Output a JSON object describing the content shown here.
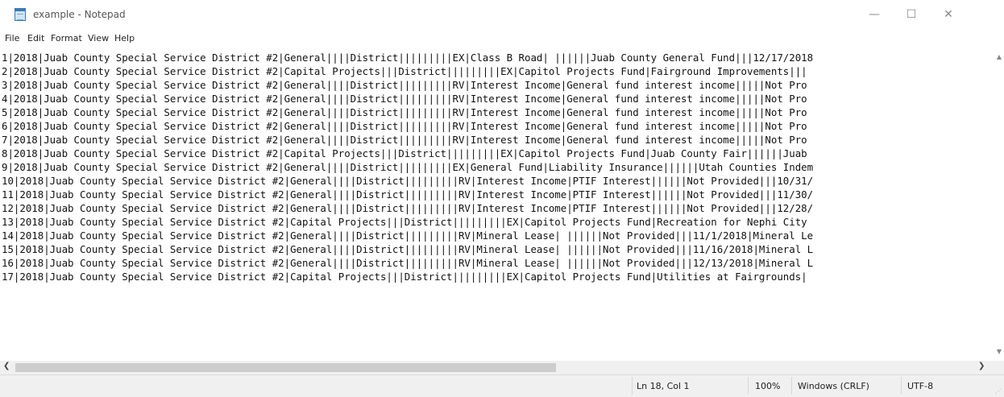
{
  "window": {
    "title": "example - Notepad",
    "minimize_glyph": "—",
    "maximize_glyph": "☐",
    "close_glyph": "✕",
    "icon": "notepad-icon"
  },
  "menu": [
    "File",
    "Edit",
    "Format",
    "View",
    "Help"
  ],
  "lines": [
    "1|2018|Juab County Special Service District #2|General||||District|||||||||EX|Class B Road| ||||||Juab County General Fund|||12/17/2018",
    "2|2018|Juab County Special Service District #2|Capital Projects|||District|||||||||EX|Capitol Projects Fund|Fairground Improvements|||",
    "3|2018|Juab County Special Service District #2|General||||District|||||||||RV|Interest Income|General fund interest income|||||Not Pro",
    "4|2018|Juab County Special Service District #2|General||||District|||||||||RV|Interest Income|General fund interest income|||||Not Pro",
    "5|2018|Juab County Special Service District #2|General||||District|||||||||RV|Interest Income|General fund interest income|||||Not Pro",
    "6|2018|Juab County Special Service District #2|General||||District|||||||||RV|Interest Income|General fund interest income|||||Not Pro",
    "7|2018|Juab County Special Service District #2|General||||District|||||||||RV|Interest Income|General fund interest income|||||Not Pro",
    "8|2018|Juab County Special Service District #2|Capital Projects|||District|||||||||EX|Capitol Projects Fund|Juab County Fair||||||Juab",
    "9|2018|Juab County Special Service District #2|General||||District|||||||||EX|General Fund|Liability Insurance||||||Utah Counties Indem",
    "10|2018|Juab County Special Service District #2|General||||District|||||||||RV|Interest Income|PTIF Interest||||||Not Provided|||10/31/",
    "11|2018|Juab County Special Service District #2|General||||District|||||||||RV|Interest Income|PTIF Interest||||||Not Provided|||11/30/",
    "12|2018|Juab County Special Service District #2|General||||District|||||||||RV|Interest Income|PTIF Interest||||||Not Provided|||12/28/",
    "13|2018|Juab County Special Service District #2|Capital Projects|||District|||||||||EX|Capitol Projects Fund|Recreation for Nephi City",
    "14|2018|Juab County Special Service District #2|General||||District|||||||||RV|Mineral Lease| ||||||Not Provided|||11/1/2018|Mineral Le",
    "15|2018|Juab County Special Service District #2|General||||District|||||||||RV|Mineral Lease| ||||||Not Provided|||11/16/2018|Mineral L",
    "16|2018|Juab County Special Service District #2|General||||District|||||||||RV|Mineral Lease| ||||||Not Provided|||12/13/2018|Mineral L",
    "17|2018|Juab County Special Service District #2|Capital Projects|||District|||||||||EX|Capitol Projects Fund|Utilities at Fairgrounds|"
  ],
  "scroll": {
    "up": "▲",
    "down": "▼",
    "left": "❮",
    "right": "❯"
  },
  "status": {
    "position": "Ln 18, Col 1",
    "zoom": "100%",
    "line_ending": "Windows (CRLF)",
    "encoding": "UTF-8"
  }
}
